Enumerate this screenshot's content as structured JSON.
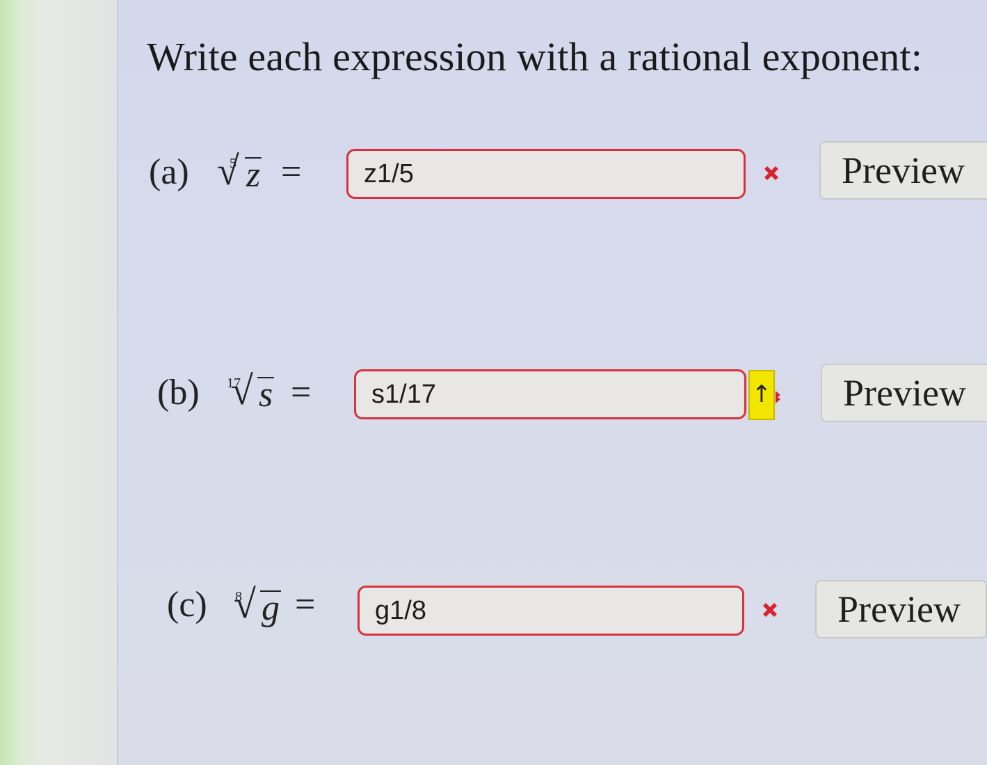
{
  "title": "Write each expression with a rational exponent:",
  "parts": [
    {
      "label": "(a)",
      "index": "5",
      "variable": "z",
      "equals": "=",
      "answer": "z1/5",
      "status_icon": "x-icon",
      "preview_label": "Preview"
    },
    {
      "label": "(b)",
      "index": "17",
      "variable": "s",
      "equals": "=",
      "answer": "s1/17",
      "status_icon": "up-arrow-icon",
      "arrow_glyph": "↑",
      "preview_label": "Preview"
    },
    {
      "label": "(c)",
      "index": "8",
      "variable": "g",
      "equals": "=",
      "answer": "g1/8",
      "status_icon": "x-icon",
      "preview_label": "Preview"
    }
  ],
  "colors": {
    "error_border": "#d8313d",
    "error_icon": "#d8232f",
    "hint_highlight": "#f2e600"
  }
}
